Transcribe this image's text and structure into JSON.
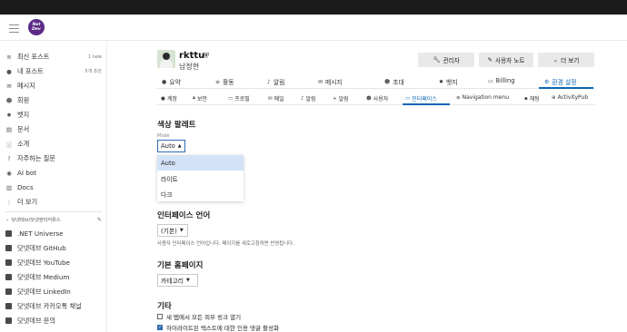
{
  "header": {
    "logo_text": "Net Dev"
  },
  "sidebar": {
    "items": [
      {
        "label": "최신 포스트",
        "icon": "layers-icon",
        "badge": "1 new"
      },
      {
        "label": "내 포스트",
        "icon": "user-icon",
        "badge": "5개 초안"
      },
      {
        "label": "메시지",
        "icon": "envelope-icon",
        "badge": ""
      },
      {
        "label": "회원",
        "icon": "users-icon",
        "badge": ""
      },
      {
        "label": "뱃지",
        "icon": "certificate-icon",
        "badge": ""
      },
      {
        "label": "문서",
        "icon": "book-icon",
        "badge": ""
      },
      {
        "label": "소개",
        "icon": "info-icon",
        "badge": ""
      },
      {
        "label": "자주하는 질문",
        "icon": "question-icon",
        "badge": ""
      },
      {
        "label": "AI bot",
        "icon": "robot-icon",
        "badge": ""
      },
      {
        "label": "Docs",
        "icon": "docs-icon",
        "badge": ""
      },
      {
        "label": "더 보기",
        "icon": "more-icon",
        "badge": ""
      }
    ],
    "section_title": "닷넷데브/닷넷엔터커뮤스",
    "links": [
      ".NET Universe",
      "닷넷데브 GitHub",
      "닷넷데브 YouTube",
      "닷넷데브 Medium",
      "닷넷데브 LinkedIn",
      "닷넷데브 카카오톡 채널",
      "닷넷데브 문의"
    ]
  },
  "profile": {
    "username": "rkttu",
    "realname": "남정현",
    "buttons": {
      "admin": "관리자",
      "notes": "사용자 노트",
      "more": "더 보기"
    }
  },
  "nav1": {
    "tabs": [
      "요약",
      "활동",
      "알림",
      "메시지",
      "초대",
      "뱃지",
      "Billing",
      "환경 설정"
    ],
    "active": "환경 설정"
  },
  "nav2": {
    "tabs": [
      "계정",
      "보안",
      "프로필",
      "메일",
      "알림",
      "알림",
      "사용자",
      "인터페이스",
      "Navigation menu",
      "채팅",
      "ActivityPub"
    ],
    "active": "인터페이스"
  },
  "settings": {
    "palette_title": "색상 팔레트",
    "mode_label": "Mode",
    "mode_value": "Auto",
    "mode_options": [
      "Auto",
      "라이트",
      "다크"
    ],
    "language_title": "인터페이스 언어",
    "language_value": "(기본)",
    "language_help": "사용자 인터페이스 언어입니다. 페이지를 새로고침하면 반영됩니다.",
    "homepage_title": "기본 홈페이지",
    "homepage_value": "카테고리",
    "other_title": "기타",
    "option1": "새 탭에서 모든 외부 링크 열기",
    "option2": "하이라이트된 텍스트에 대한 인용 댓글 활성화"
  }
}
